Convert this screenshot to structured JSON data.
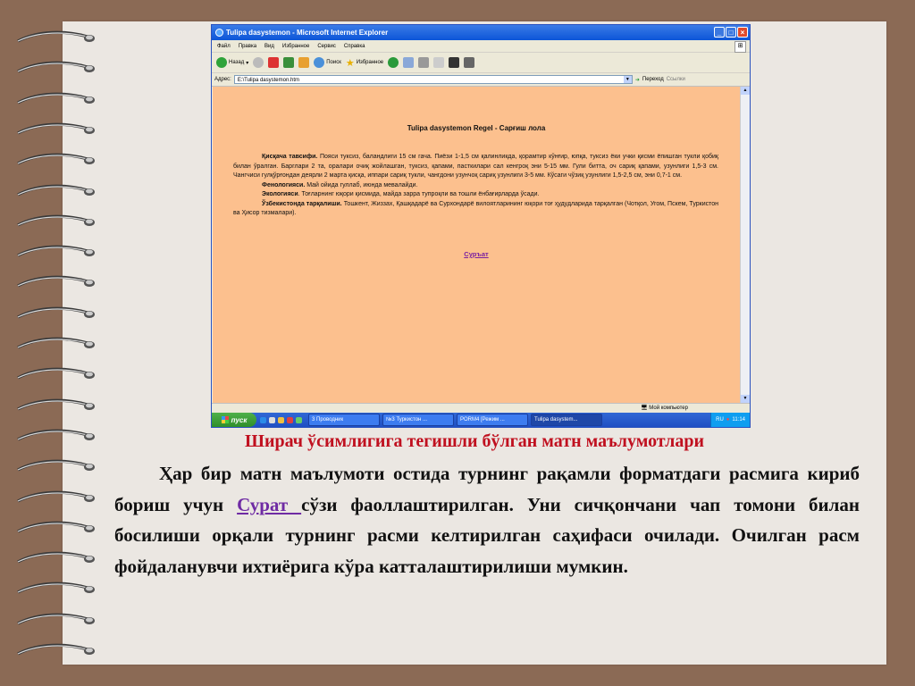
{
  "window": {
    "title": "Tulipa dasystemon - Microsoft Internet Explorer",
    "menu": [
      "Файл",
      "Правка",
      "Вид",
      "Избранное",
      "Сервис",
      "Справка"
    ],
    "toolbar": {
      "back": "Назад",
      "search": "Поиск",
      "favorites": "Избранное"
    },
    "address": {
      "label": "Адрес:",
      "value": "E:\\Tulipa dasystemon.htm",
      "go": "Переход",
      "links": "Ссылки"
    }
  },
  "document": {
    "title": "Tulipa dasystemon Regel - Сарғиш лола",
    "desc_label": "Қисқача тавсифи.",
    "desc_text": " Пояси туксиз, баландлиги 15 см гача. Пиёзи 1-1,5 см қалинликда, қорамтир кўнғир, юпқа, туксиз ёки учки қисми ёпишган тукли қобиқ билан ўралган. Барглари 2 та, оралари очиқ жойлашган, туксиз, қапами, пасткилари сал кенгроқ эни 5-15 мм. Гули битта, оч сариқ қапами, узунлиги 1,5-3 см. Чангчиси гулқўрғондан деярли 2 марта қисқа, иппари сариқ тукли, чангдони узунчоқ сариқ узунлиги 3-5 мм. Кўсаги чўзиқ узунлиги 1,5-2,5 см, эни 0,7-1 см.",
    "phen_label": "Фенологияси.",
    "phen_text": " Май ойида гуллаб, июнда мевалайди.",
    "eco_label": "Экологияси",
    "eco_text": ". Тоғларнинг юқори қисмида, майда зарра тупроқли ва тошли ёнбағирларда ўсади.",
    "dist_label": "Ўзбекистонда тарқалиши.",
    "dist_text": " Тошкент, Жиззах, Қашқадарё ва Сурхондарё вилоятларининг юқори тоғ ҳудудларида тарқалган (Чотқол, Угом, Пскем, Туркистон ва Ҳисор тизмалари).",
    "link": "Суръат"
  },
  "status": {
    "zone": "Мой компьютер"
  },
  "taskbar": {
    "start": "пуск",
    "tasks": [
      "3 Проводник",
      "№3 Туркистон ...",
      "PORM4 [Режим ...",
      "Tulipa dasystem..."
    ],
    "lang": "RU",
    "time": "11:14"
  },
  "slide": {
    "caption": "Ширач ўсимлигига тегишли бўлган матн маълумотлари",
    "para_part1": "Ҳар бир матн маълумоти остида турнинг рақамли форматдаги расмига кириб бориш учун ",
    "para_keyword": "Сурат   ",
    "para_part2": "сўзи фаоллаштирилган. Уни сичқончани чап томони билан босилиши орқали турнинг расми келтирилган саҳифаси очилади. Очилган расм фойдаланувчи ихтиёрига кўра катталаштирилиши мумкин."
  }
}
